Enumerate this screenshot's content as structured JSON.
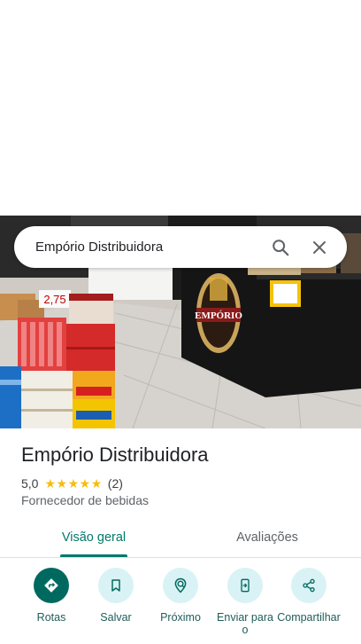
{
  "search": {
    "query": "Empório Distribuidora"
  },
  "place": {
    "name": "Empório Distribuidora",
    "rating": "5,0",
    "stars": 5,
    "review_count": "(2)",
    "category": "Fornecedor de bebidas"
  },
  "photo": {
    "price_sign": "2,75",
    "store_logo": "EMPÓRIO"
  },
  "tabs": [
    {
      "label": "Visão geral",
      "active": true
    },
    {
      "label": "Avaliações",
      "active": false
    }
  ],
  "actions": [
    {
      "label": "Rotas",
      "icon": "directions-icon"
    },
    {
      "label": "Salvar",
      "icon": "bookmark-icon"
    },
    {
      "label": "Próximo",
      "icon": "nearby-icon"
    },
    {
      "label": "Enviar para o",
      "icon": "send-to-phone-icon"
    },
    {
      "label": "Compartilhar",
      "icon": "share-icon"
    }
  ],
  "colors": {
    "accent": "#00796b",
    "star": "#fbbc04",
    "action_bg": "#d9f2f5",
    "primary_action": "#00695f"
  }
}
